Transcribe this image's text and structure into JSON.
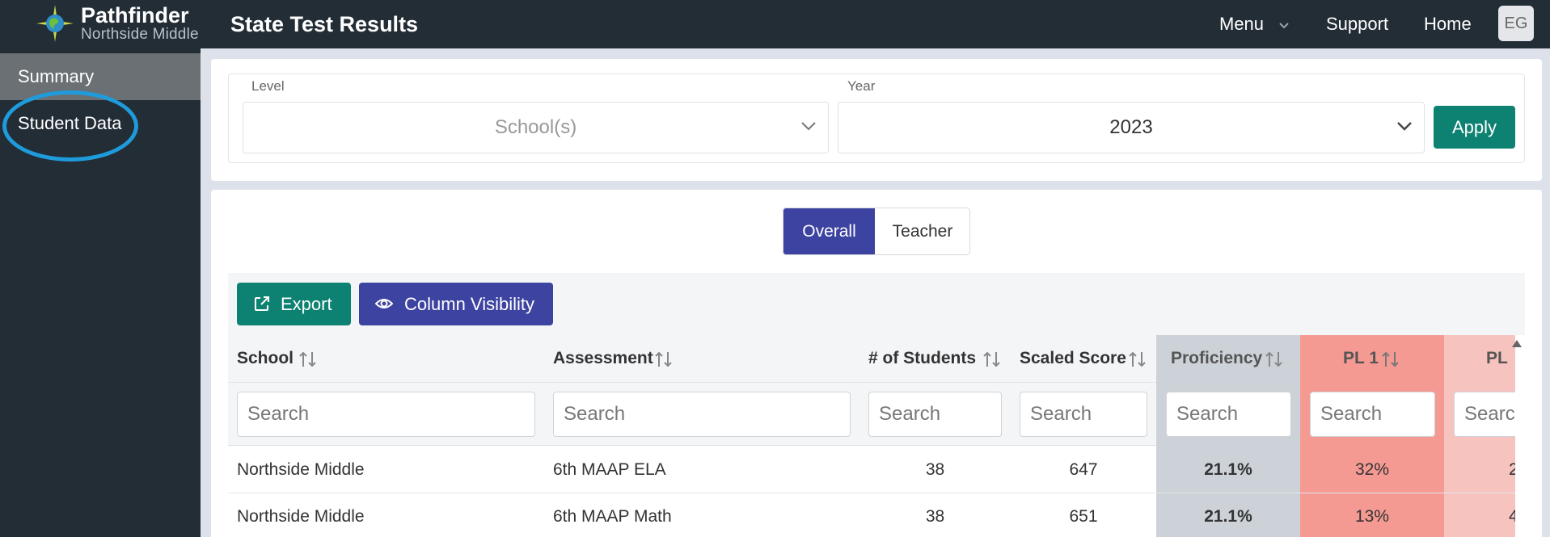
{
  "header": {
    "brand": "Pathfinder",
    "brand_sub": "Northside Middle",
    "page_title": "State Test Results",
    "nav": {
      "menu": "Menu",
      "support": "Support",
      "home": "Home"
    },
    "avatar_initials": "EG"
  },
  "sidebar": {
    "items": [
      {
        "label": "Summary",
        "active": true
      },
      {
        "label": "Student Data",
        "active": false
      }
    ]
  },
  "filters": {
    "level": {
      "label": "Level",
      "placeholder": "School(s)"
    },
    "year": {
      "label": "Year",
      "value": "2023"
    },
    "apply_label": "Apply"
  },
  "view_toggle": {
    "options": [
      "Overall",
      "Teacher"
    ],
    "selected": "Overall"
  },
  "toolbar": {
    "export_label": "Export",
    "column_visibility_label": "Column Visibility"
  },
  "table": {
    "columns": [
      "School",
      "Assessment",
      "# of Students",
      "Scaled Score",
      "Proficiency",
      "PL 1",
      "PL"
    ],
    "search_placeholder": "Search",
    "search_placeholder_truncated": "Searc",
    "rows": [
      {
        "school": "Northside Middle",
        "assessment": "6th MAAP ELA",
        "students": "38",
        "scaled": "647",
        "proficiency": "21.1%",
        "pl1": "32%",
        "pl2": "2"
      },
      {
        "school": "Northside Middle",
        "assessment": "6th MAAP Math",
        "students": "38",
        "scaled": "651",
        "proficiency": "21.1%",
        "pl1": "13%",
        "pl2": "4"
      }
    ]
  },
  "colors": {
    "topbar": "#222d36",
    "accent_green": "#0e8272",
    "accent_indigo": "#3d43a0",
    "proficiency_col": "#ccd2d7",
    "pl1_col": "#f59a93",
    "pl2_col": "#f7c3bf",
    "annotation_circle": "#1f9bdb"
  },
  "icons": [
    "compass-logo-icon",
    "chevron-down-icon",
    "external-link-icon",
    "eye-icon",
    "sort-icon",
    "scroll-up-icon"
  ]
}
